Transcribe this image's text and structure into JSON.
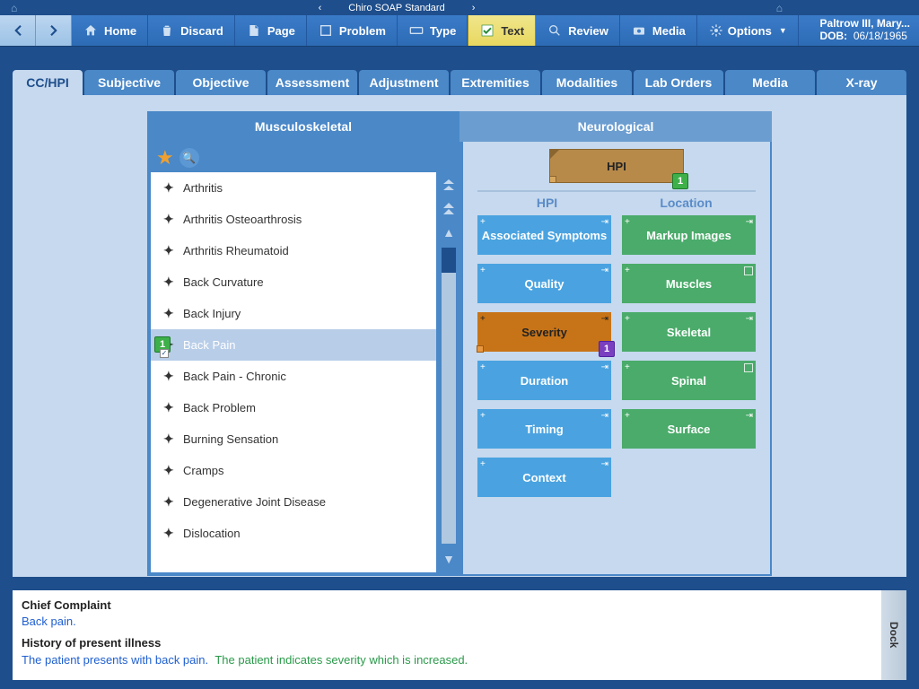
{
  "app_title": "Chiro SOAP Standard",
  "patient": {
    "name": "Paltrow III, Mary...",
    "dob_label": "DOB:",
    "dob": "06/18/1965"
  },
  "toolbar": {
    "home": "Home",
    "discard": "Discard",
    "page": "Page",
    "problem": "Problem",
    "type": "Type",
    "text": "Text",
    "review": "Review",
    "media": "Media",
    "options": "Options"
  },
  "tabs": [
    "CC/HPI",
    "Subjective",
    "Objective",
    "Assessment",
    "Adjustment",
    "Extremities",
    "Modalities",
    "Lab Orders",
    "Media",
    "X-ray"
  ],
  "active_tab": "CC/HPI",
  "panel_tabs": {
    "left": "Musculoskeletal",
    "right": "Neurological",
    "active": "left"
  },
  "list_items": [
    "Arthritis",
    "Arthritis Osteoarthrosis",
    "Arthritis Rheumatoid",
    "Back Curvature",
    "Back Injury",
    "Back Pain",
    "Back Pain - Chronic",
    "Back Problem",
    "Burning Sensation",
    "Cramps",
    "Degenerative Joint Disease",
    "Dislocation"
  ],
  "selected_item": "Back Pain",
  "selected_badge": "1",
  "hpi_banner": {
    "label": "HPI",
    "badge": "1"
  },
  "columns": {
    "left": "HPI",
    "right": "Location"
  },
  "tiles_left": [
    {
      "label": "Associated Symptoms",
      "style": "blue"
    },
    {
      "label": "Quality",
      "style": "blue"
    },
    {
      "label": "Severity",
      "style": "orange",
      "badge": "1"
    },
    {
      "label": "Duration",
      "style": "blue"
    },
    {
      "label": "Timing",
      "style": "blue"
    },
    {
      "label": "Context",
      "style": "blue"
    }
  ],
  "tiles_right": [
    {
      "label": "Markup Images",
      "style": "green"
    },
    {
      "label": "Muscles",
      "style": "green",
      "box": true
    },
    {
      "label": "Skeletal",
      "style": "green"
    },
    {
      "label": "Spinal",
      "style": "green",
      "box": true
    },
    {
      "label": "Surface",
      "style": "green"
    }
  ],
  "summary": {
    "cc_heading": "Chief Complaint",
    "cc_text": "Back pain.",
    "hpi_heading": "History of present illness",
    "hpi_text1": "The patient presents with back pain.",
    "hpi_text2": "The patient indicates severity which is increased."
  },
  "dock_label": "Dock"
}
